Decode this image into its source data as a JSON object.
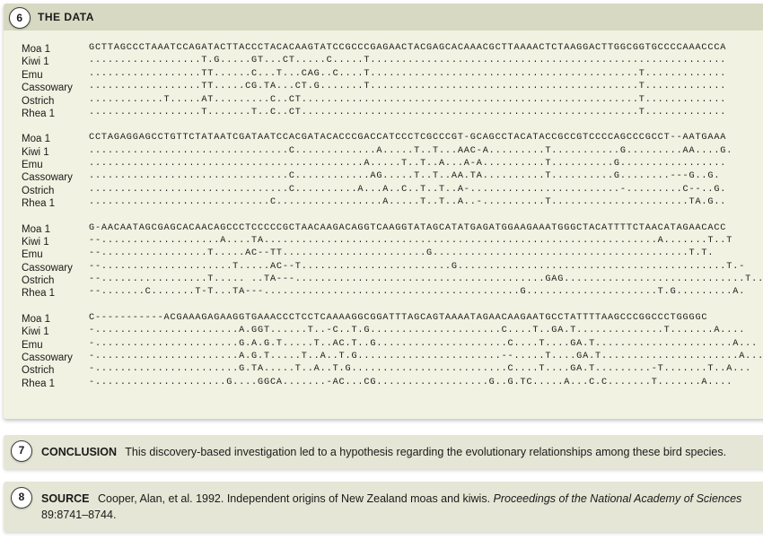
{
  "data_panel": {
    "badge": "6",
    "title": "THE DATA",
    "labels": [
      "Moa 1",
      "Kiwi 1",
      "Emu",
      "Cassowary",
      "Ostrich",
      "Rhea 1"
    ],
    "blocks": [
      [
        "GCTTAGCCCTAAATCCAGATACTTACCCTACACAAGTATCCGCCCGAGAACTACGAGCACAAACGCTTAAAACTCTAAGGACTTGGCGGTGCCCCAAACCCA",
        "..................T.G.....GT...CT.....C.....T.........................................................",
        "..................TT......C...T...CAG..C....T...........................................T.............",
        "..................TT.....CG.TA...CT.G.......T...........................................T.............",
        "............T.....AT.........C..CT......................................................T.............",
        "..................T.......T..C..CT......................................................T............."
      ],
      [
        "CCTAGAGGAGCCTGTTCTATAATCGATAATCCACGATACACCCGACCATCCCTCGCCCGT-GCAGCCTACATACCGCCGTCCCCAGCCCGCCT--AATGAAA",
        "................................C.............A.....T..T...AAC-A.........T...........G.........AA....G.",
        "............................................A.....T..T..A...A-A..........T..........G.................",
        "................................C............AG.....T..T..AA.TA..........T..........G........---G..G.",
        "................................C..........A...A..C..T..T..A-........................-.........C--..G.",
        ".............................C.................A.....T..T..A..-..........T......................TA.G.."
      ],
      [
        "G-AACAATAGCGAGCACAACAGCCCTCCCCCGCTAACAAGACAGGTCAAGGTATAGCATATGAGATGGAAGAAATGGGCTACATTTTCTAACATAGAACACC",
        "--...................A....TA...............................................................A.......T..T",
        "--.................T.....AC--TT.......................G.........................................T.T.",
        "--.....................T.....AC--T........................G...........................................T.-",
        "--.................T..... ..TA---........................................GAG.............................T..A",
        "--.......C.......T-T...TA---.........................................G.....................T.G.........A."
      ],
      [
        "C-----------ACGAAAGAGAAGGTGAAACCCTCCTCAAAAGGCGGATTTAGCAGTAAAATAGAACAAGAATGCCTATTTTAAGCCCGGCCCTGGGGC",
        "-.......................A.GGT......T..-C..T.G.....................C....T..GA.T..............T.......A....",
        "-.......................G.A.G.T.....T..AC.T..G.....................C....T....GA.T......................A...",
        "-.......................A.G.T.....T..A..T.G.......................--.....T....GA.T......................A...",
        "-.......................G.TA.....T..A..T.G.........................C....T....GA.T.........-T.......T..A...",
        "-.....................G....GGCA.......-AC...CG..................G..G.TC.....A...C.C.......T.......A...."
      ]
    ]
  },
  "conclusion": {
    "badge": "7",
    "label": "CONCLUSION",
    "text": "This discovery-based investigation led to a hypothesis regarding the evolutionary relationships among these bird species."
  },
  "source": {
    "badge": "8",
    "label": "SOURCE",
    "prefix": "Cooper, Alan, et al. 1992. Independent origins of New Zealand moas and kiwis. ",
    "italic": "Proceedings of the National Academy of Sciences",
    "suffix": " 89:8741–8744."
  }
}
